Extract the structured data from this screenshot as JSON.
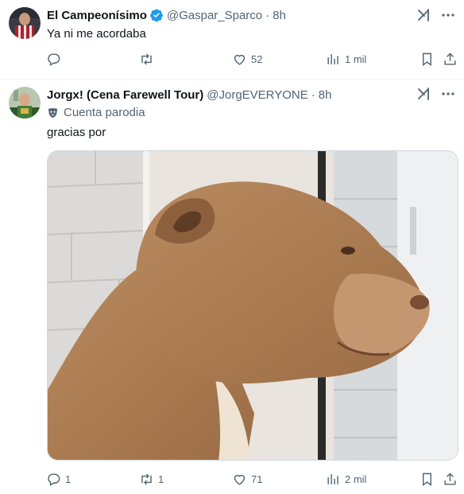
{
  "tweets": [
    {
      "name": "El Campeonísimo",
      "handle": "@Gaspar_Sparco",
      "time": "8h",
      "verified": true,
      "text": "Ya ni me acordaba",
      "stats": {
        "replies": "",
        "retweets": "",
        "likes": "52",
        "views": "1 mil"
      }
    },
    {
      "name": "Jorgx! (Cena Farewell Tour)",
      "handle": "@JorgEVERYONE",
      "time": "8h",
      "parody_label": "Cuenta parodia",
      "text": "gracias por",
      "media": "dog-meme-image",
      "stats": {
        "replies": "1",
        "retweets": "1",
        "likes": "71",
        "views": "2 mil"
      }
    }
  ],
  "separator": "·",
  "icons": [
    "reply-icon",
    "retweet-icon",
    "like-icon",
    "views-icon",
    "bookmark-icon",
    "share-icon",
    "grok-icon",
    "more-icon",
    "verified-badge-icon",
    "parody-mask-icon"
  ],
  "colors": {
    "text": "#0f1419",
    "secondary": "#536471",
    "verified": "#1d9bf0",
    "divider": "#eff3f4"
  }
}
